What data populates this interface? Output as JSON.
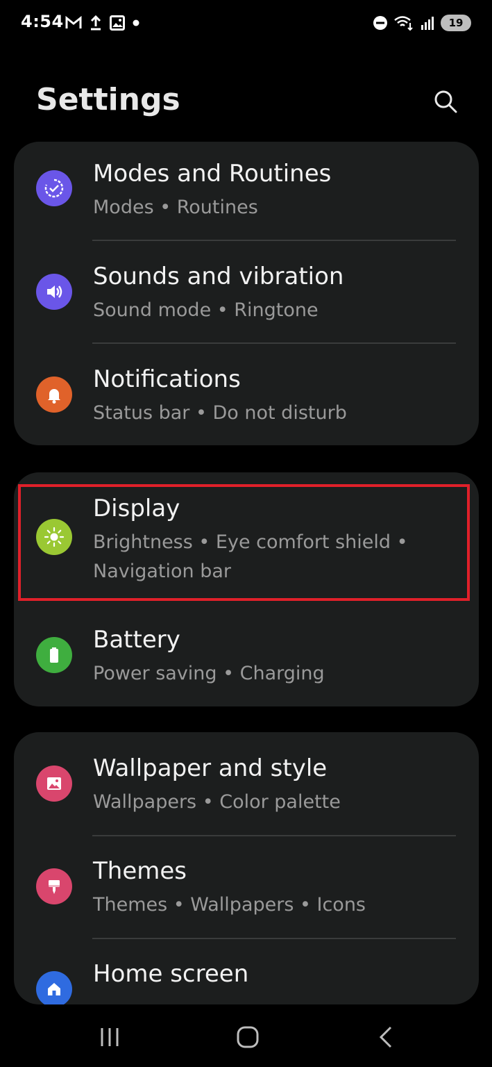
{
  "status_bar": {
    "time": "4:54",
    "battery": "19",
    "left_icons": [
      "gmail-icon",
      "upload-icon",
      "image-icon",
      "dot-icon"
    ],
    "right_icons": [
      "dnd-icon",
      "wifi-icon",
      "signal-icon",
      "battery-icon"
    ]
  },
  "header": {
    "title": "Settings",
    "search_icon": "search-icon"
  },
  "groups": [
    {
      "items": [
        {
          "title": "Modes and Routines",
          "subtitle": "Modes  •  Routines",
          "icon": "modes-routines-icon",
          "icon_color": "#6a56e8"
        },
        {
          "title": "Sounds and vibration",
          "subtitle": "Sound mode  •  Ringtone",
          "icon": "speaker-icon",
          "icon_color": "#6a56e8"
        },
        {
          "title": "Notifications",
          "subtitle": "Status bar  •  Do not disturb",
          "icon": "bell-icon",
          "icon_color": "#e0622a"
        }
      ]
    },
    {
      "items": [
        {
          "title": "Display",
          "subtitle": "Brightness  •  Eye comfort shield  •  Navigation bar",
          "icon": "sun-icon",
          "icon_color": "#9ac833"
        },
        {
          "title": "Battery",
          "subtitle": "Power saving  •  Charging",
          "icon": "battery-icon",
          "icon_color": "#3fae3f"
        }
      ]
    },
    {
      "items": [
        {
          "title": "Wallpaper and style",
          "subtitle": "Wallpapers  •  Color palette",
          "icon": "picture-icon",
          "icon_color": "#d9466d"
        },
        {
          "title": "Themes",
          "subtitle": "Themes  •  Wallpapers  •  Icons",
          "icon": "brush-icon",
          "icon_color": "#d9466d"
        },
        {
          "title": "Home screen",
          "subtitle": "",
          "icon": "home-icon",
          "icon_color": "#2f6be0"
        }
      ]
    }
  ],
  "nav_bar": {
    "recents_icon": "recents-icon",
    "home_icon": "home-button-icon",
    "back_icon": "back-icon"
  },
  "colors": {
    "background": "#000000",
    "card": "#1c1e1e",
    "highlight": "#e0202a"
  }
}
